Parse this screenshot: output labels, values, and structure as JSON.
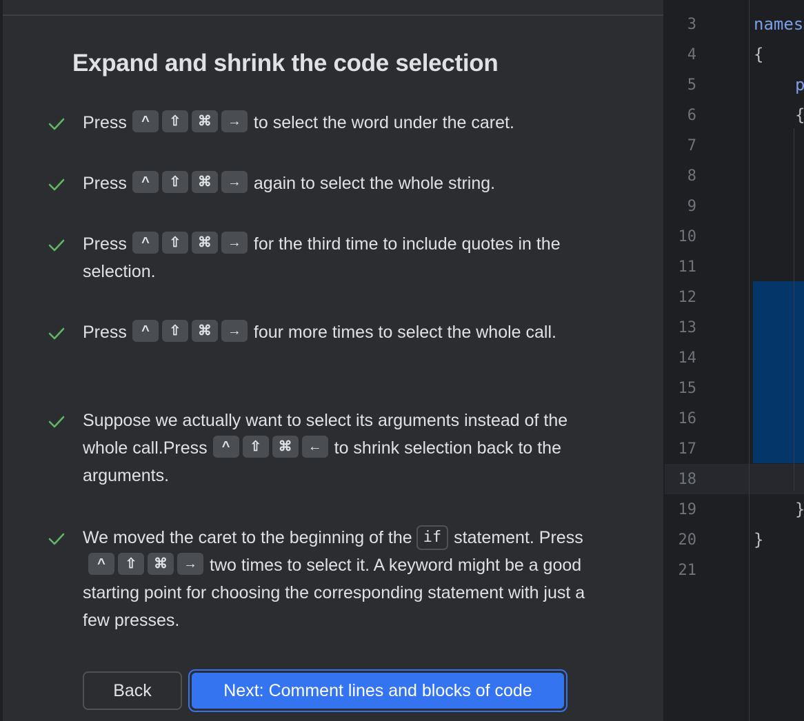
{
  "lesson": {
    "title": "Expand and shrink the code selection",
    "steps": [
      {
        "before": "Press",
        "keys": [
          "^",
          "⇧",
          "⌘",
          "→"
        ],
        "after": "to select the word under the caret."
      },
      {
        "before": "Press",
        "keys": [
          "^",
          "⇧",
          "⌘",
          "→"
        ],
        "after": "again to select the whole string."
      },
      {
        "before": "Press",
        "keys": [
          "^",
          "⇧",
          "⌘",
          "→"
        ],
        "after": "for the third time to include quotes in the selection."
      },
      {
        "before": "Press",
        "keys": [
          "^",
          "⇧",
          "⌘",
          "→"
        ],
        "after": "four more times to select the whole call."
      },
      {
        "before": "Suppose we actually want to select its arguments instead of the whole call.Press",
        "keys": [
          "^",
          "⇧",
          "⌘",
          "←"
        ],
        "after": "to shrink selection back to the arguments."
      },
      {
        "before": "We moved the caret to the beginning of the",
        "code": "if",
        "middle": "statement. Press",
        "keys": [
          "^",
          "⇧",
          "⌘",
          "→"
        ],
        "after": "two times to select it. A keyword might be a good starting point for choosing the corresponding statement with just a few presses."
      }
    ],
    "back_label": "Back",
    "next_label": "Next: Comment lines and blocks of code"
  },
  "editor": {
    "line_numbers": [
      "3",
      "4",
      "5",
      "6",
      "7",
      "8",
      "9",
      "10",
      "11",
      "12",
      "13",
      "14",
      "15",
      "16",
      "17",
      "18",
      "19",
      "20",
      "21"
    ],
    "code": {
      "line3": "names",
      "line4": "{",
      "line5": "p",
      "line6": "{",
      "line19": "}",
      "line20": "}"
    }
  },
  "colors": {
    "panel_bg": "#2b2d30",
    "editor_bg": "#1e1f22",
    "check": "#5fb865",
    "accent": "#3574f0",
    "selection": "#043669",
    "keyword": "#7a9fe8"
  },
  "icons": {
    "check": "checkmark-icon"
  }
}
